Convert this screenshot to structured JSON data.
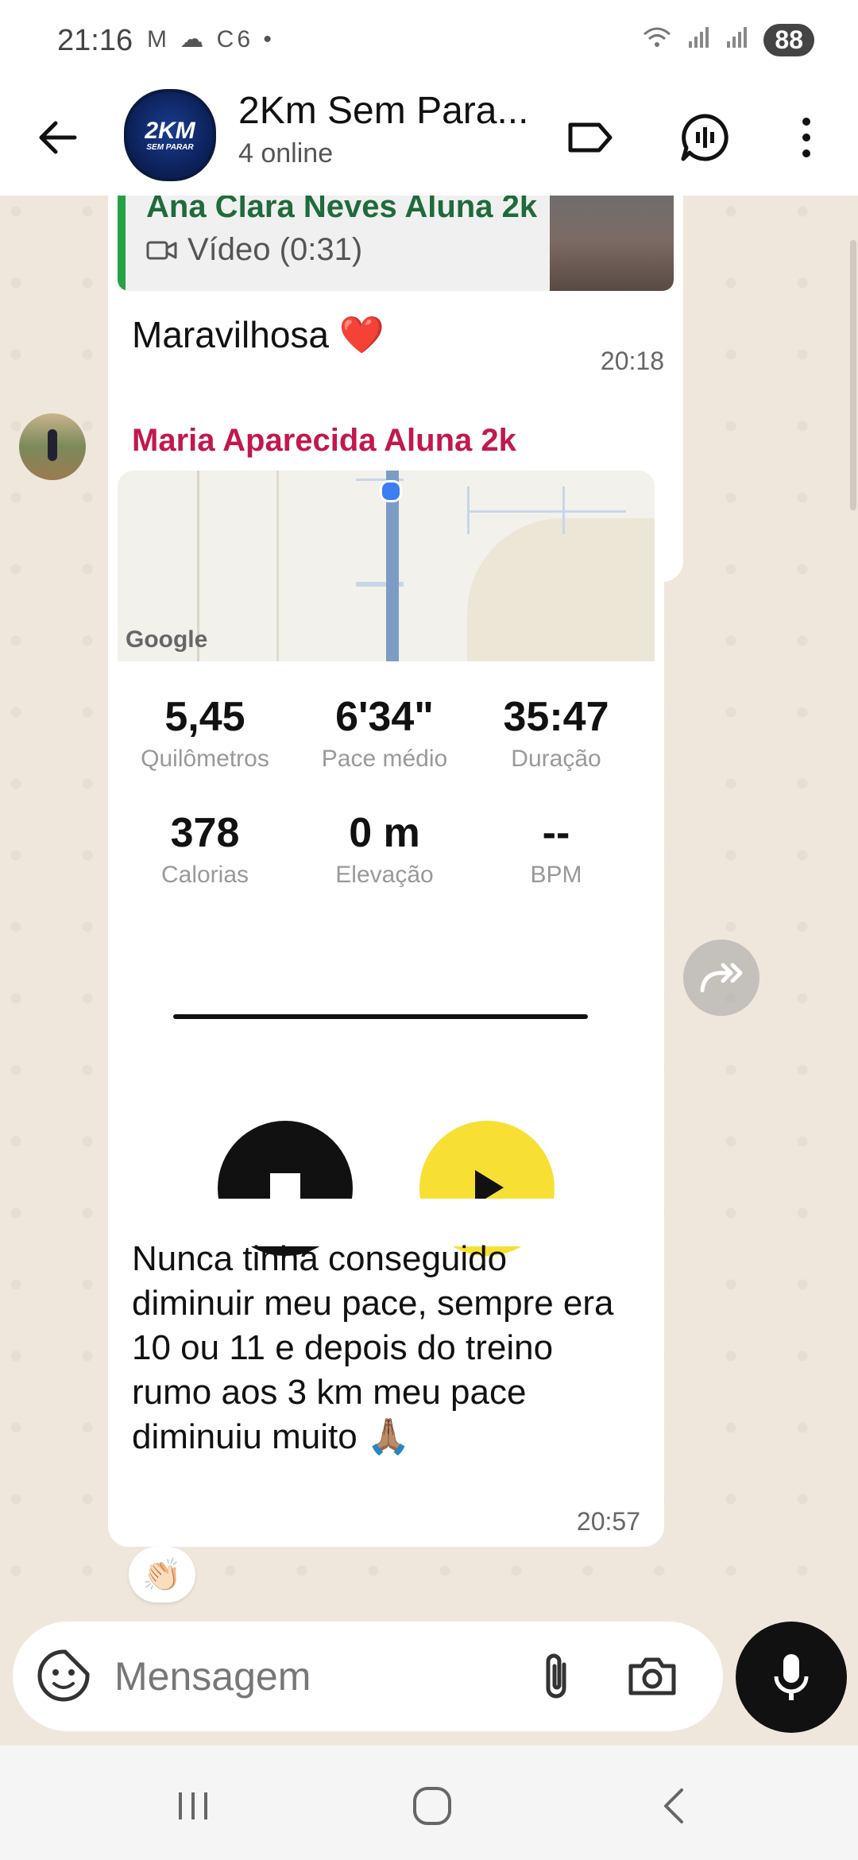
{
  "status": {
    "time": "21:16",
    "left_icons": "M ☁ C6 •",
    "battery": "88"
  },
  "header": {
    "avatar_top": "2KM",
    "avatar_bottom": "SEM PARAR",
    "title": "2Km Sem Para...",
    "subtitle": "4 online"
  },
  "messages": {
    "first": {
      "quote_author": "Ana Clara Neves Aluna 2k",
      "quote_label": "Vídeo (0:31)",
      "text": "Maravilhosa",
      "emoji": "❤️",
      "time": "20:18"
    },
    "second": {
      "sender": "Maria Aparecida Aluna 2k",
      "map_brand": "Google",
      "stats": [
        {
          "value": "5,45",
          "label": "Quilômetros"
        },
        {
          "value": "6'34\"",
          "label": "Pace médio"
        },
        {
          "value": "35:47",
          "label": "Duração"
        },
        {
          "value": "378",
          "label": "Calorias"
        },
        {
          "value": "0 m",
          "label": "Elevação"
        },
        {
          "value": "--",
          "label": "BPM"
        }
      ],
      "text": "Nunca tinha conseguido diminuir meu pace, sempre era 10 ou 11 e depois do treino rumo aos 3 km meu pace diminuiu muito 🙏🏽",
      "time": "20:57",
      "reaction": "👏🏻"
    }
  },
  "composer": {
    "placeholder": "Mensagem"
  }
}
